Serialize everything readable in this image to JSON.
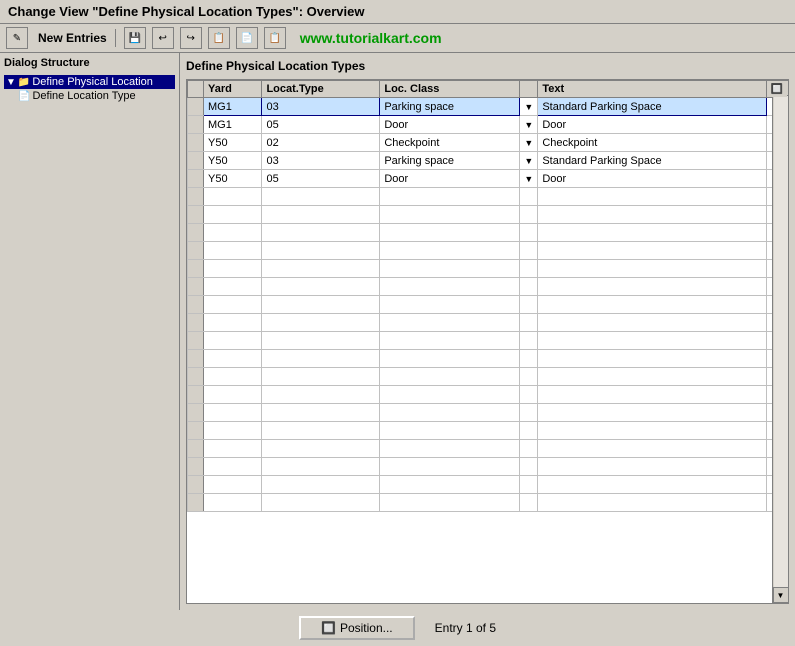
{
  "title_bar": {
    "text": "Change View \"Define Physical Location Types\": Overview"
  },
  "toolbar": {
    "new_entries_label": "New Entries",
    "watermark": "www.tutorialkart.com",
    "buttons": [
      {
        "name": "new-entries-icon",
        "symbol": "✎"
      },
      {
        "name": "save-icon",
        "symbol": "💾"
      },
      {
        "name": "copy-icon",
        "symbol": "📋"
      },
      {
        "name": "undo-icon",
        "symbol": "↩"
      },
      {
        "name": "redo-icon",
        "symbol": "↪"
      },
      {
        "name": "other-icon",
        "symbol": "📄"
      },
      {
        "name": "extra-icon",
        "symbol": "📋"
      }
    ]
  },
  "left_panel": {
    "title": "Dialog Structure",
    "tree": [
      {
        "id": "node1",
        "label": "Define Physical Location",
        "indent": 0,
        "selected": true,
        "icon": "▼ 📁"
      },
      {
        "id": "node2",
        "label": "Define Location Type",
        "indent": 1,
        "selected": false,
        "icon": "📄"
      }
    ]
  },
  "content": {
    "title": "Define Physical Location Types",
    "table": {
      "columns": [
        {
          "id": "selector",
          "label": ""
        },
        {
          "id": "yard",
          "label": "Yard"
        },
        {
          "id": "locat_type",
          "label": "Locat.Type"
        },
        {
          "id": "loc_class",
          "label": "Loc. Class"
        },
        {
          "id": "dropdown",
          "label": ""
        },
        {
          "id": "text",
          "label": "Text"
        },
        {
          "id": "table_icon",
          "label": "🔲"
        }
      ],
      "rows": [
        {
          "yard": "MG1",
          "locat_type": "03",
          "loc_class": "Parking space",
          "text": "Standard Parking Space",
          "selected": true
        },
        {
          "yard": "MG1",
          "locat_type": "05",
          "loc_class": "Door",
          "text": "Door",
          "selected": false
        },
        {
          "yard": "Y50",
          "locat_type": "02",
          "loc_class": "Checkpoint",
          "text": "Checkpoint",
          "selected": false
        },
        {
          "yard": "Y50",
          "locat_type": "03",
          "loc_class": "Parking space",
          "text": "Standard Parking Space",
          "selected": false
        },
        {
          "yard": "Y50",
          "locat_type": "05",
          "loc_class": "Door",
          "text": "Door",
          "selected": false
        }
      ],
      "empty_rows": 18
    }
  },
  "bottom_bar": {
    "position_btn_label": "Position...",
    "entry_info": "Entry 1 of 5"
  }
}
